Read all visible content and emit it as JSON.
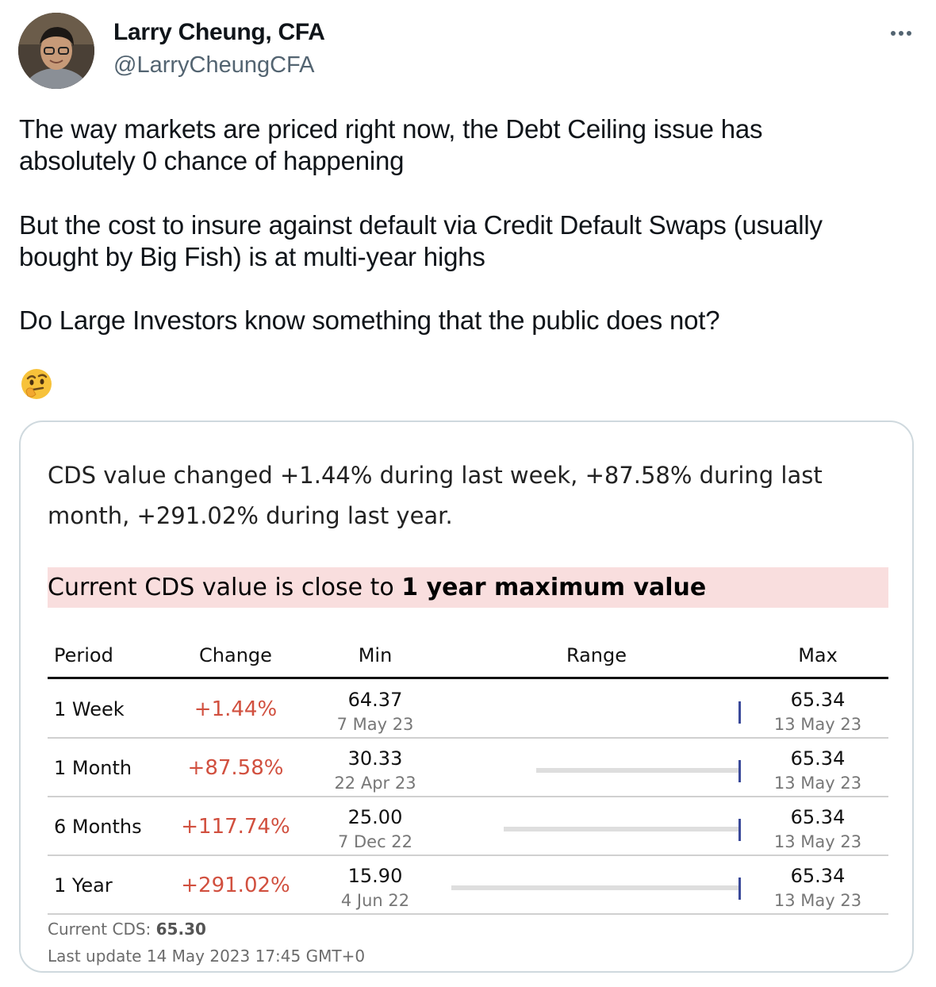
{
  "author": {
    "name": "Larry Cheung, CFA",
    "handle": "@LarryCheungCFA"
  },
  "tweet": {
    "lines": [
      "The way markets are priced right now, the Debt Ceiling issue has",
      "absolutely 0 chance of happening",
      "But the cost to insure against default via Credit Default Swaps (usually",
      "bought by Big Fish) is at multi-year highs",
      "Do Large Investors know something that the public does not?"
    ],
    "emoji": "thinking-face"
  },
  "card": {
    "summary_line1": "CDS value changed +1.44% during last week, +87.58% during last",
    "summary_line2": "month, +291.02% during last year.",
    "banner_prefix": "Current CDS value is close to ",
    "banner_bold": "1 year maximum value",
    "table": {
      "headers": [
        "Period",
        "Change",
        "Min",
        "Range",
        "Max"
      ],
      "rows": [
        {
          "period": "1 Week",
          "change": "+1.44%",
          "min": "64.37",
          "min_date": "7 May 23",
          "max": "65.34",
          "max_date": "13 May 23"
        },
        {
          "period": "1 Month",
          "change": "+87.58%",
          "min": "30.33",
          "min_date": "22 Apr 23",
          "max": "65.34",
          "max_date": "13 May 23"
        },
        {
          "period": "6 Months",
          "change": "+117.74%",
          "min": "25.00",
          "min_date": "7 Dec 22",
          "max": "65.34",
          "max_date": "13 May 23"
        },
        {
          "period": "1 Year",
          "change": "+291.02%",
          "min": "15.90",
          "min_date": "4 Jun 22",
          "max": "65.34",
          "max_date": "13 May 23"
        }
      ]
    },
    "current_label": "Current CDS: ",
    "current_value": "65.30",
    "last_update": "Last update 14 May 2023 17:45 GMT+0"
  },
  "colors": {
    "change_positive": "#d1503f",
    "banner_bg": "#f9dede",
    "range_marker": "#3b4a9a"
  }
}
